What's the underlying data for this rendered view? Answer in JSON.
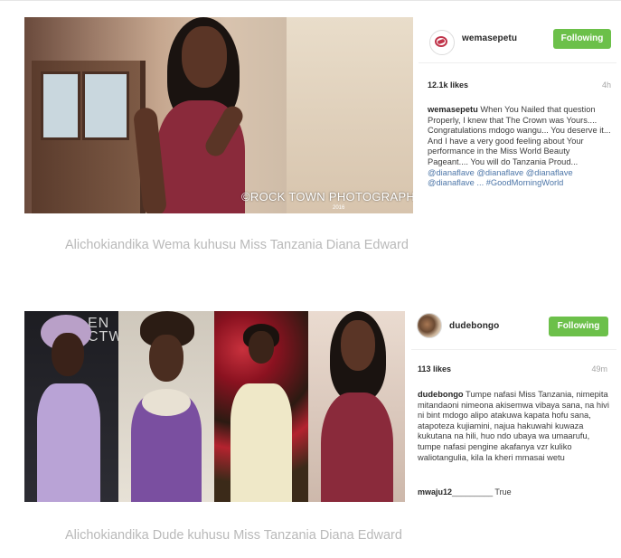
{
  "posts": [
    {
      "username": "wemasepetu",
      "follow_label": "Following",
      "likes": "12.1k likes",
      "time": "4h",
      "caption_user": "wemasepetu",
      "caption_text": " When You Nailed that question Properly, I knew that The Crown was Yours.... Congratulations mdogo wangu... You deserve it... And I have a very good feeling about Your performance in the Miss World Beauty Pageant.... You will do Tanzania Proud... ",
      "caption_tags": "@dianaflave @dianaflave @dianaflave @dianaflave ... #GoodMorningWorld",
      "photo_watermark": "©ROCK TOWN PHOTOGRAPHY",
      "photo_watermark_year": "2016"
    },
    {
      "username": "dudebongo",
      "follow_label": "Following",
      "likes": "113 likes",
      "time": "49m",
      "caption_user": "dudebongo",
      "caption_text": " Tumpe nafasi Miss Tanzania, nimepita mitandaoni nimeona akisemwa vibaya sana, na hivi ni bint mdogo alipo atakuwa kapata hofu sana, atapoteza kujiamini, najua hakuwahi kuwaza kukutana na hili, huo ndo ubaya wa umaarufu, tumpe nafasi pengine akafanya vzr kuliko waliotangulia, kila la kheri mmasai wetu",
      "comment_user": "mwaju12",
      "comment_text": "_________ True",
      "panel_text": "EN\nCTW"
    }
  ],
  "titles": {
    "title1": "Alichokiandika Wema kuhusu Miss Tanzania Diana Edward",
    "title2": "Alichokiandika Dude kuhusu Miss Tanzania Diana Edward"
  },
  "colors": {
    "follow_button": "#6cc04a",
    "hashtag": "#4d76a8",
    "title_gray": "#b9b9b9"
  },
  "icons": {
    "wema_avatar": "wemasepetu-logo-icon",
    "dude_avatar": "dudebongo-avatar-icon"
  }
}
